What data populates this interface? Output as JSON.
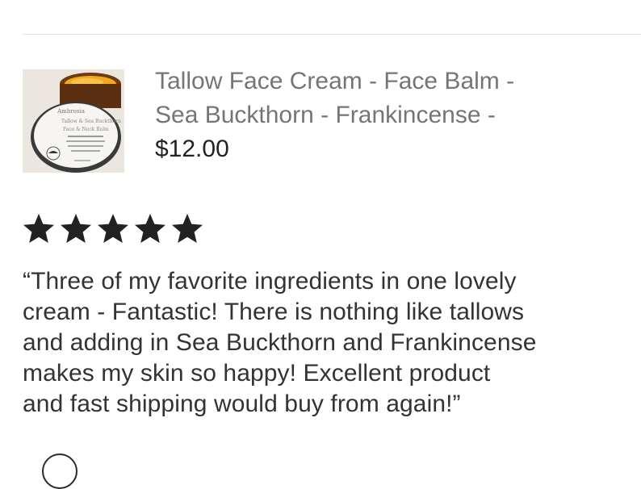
{
  "listing": {
    "title_lines": [
      "Tallow Face Cream - Face Balm -",
      "Sea Buckthorn - Frankincense -"
    ],
    "price": "$12.00",
    "thumbnail_icon": "cream-jar-image"
  },
  "rating": {
    "value": 5,
    "max": 5,
    "icon": "star-icon",
    "color": "#222222"
  },
  "review": {
    "lines": [
      "“Three of my favorite ingredients in one lovely",
      "cream - Fantastic!  There is nothing like tallows",
      "and adding in Sea Buckthorn and Frankincense",
      "makes my skin so happy!  Excellent product",
      "and fast shipping would buy from again!”"
    ]
  }
}
